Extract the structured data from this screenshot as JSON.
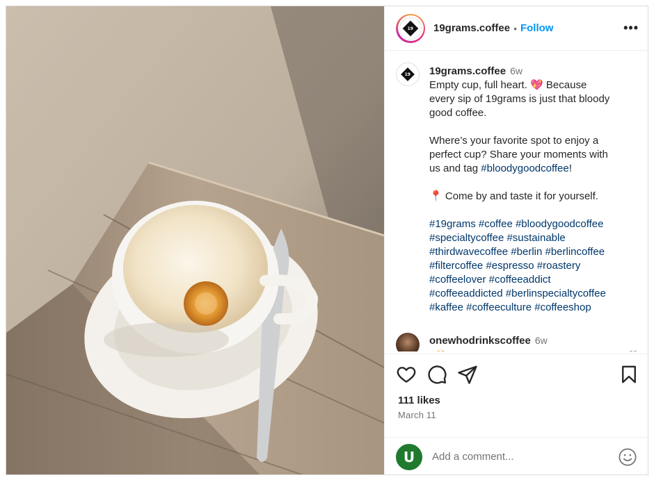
{
  "post": {
    "account": {
      "username": "19grams.coffee",
      "follow_label": "Follow",
      "separator": "•",
      "logo_text": "19"
    },
    "caption": {
      "username": "19grams.coffee",
      "time": "6w",
      "line1": "Empty cup, full heart. 💖 Because",
      "line2": "every sip of 19grams is just that bloody",
      "line3": "good coffee.",
      "line4": "Where’s your favorite spot to enjoy a",
      "line5": "perfect cup? Share your moments with",
      "line6_text": "us and tag ",
      "line6_tag": "#bloodygoodcoffee",
      "line6_end": "!",
      "line7_pin": "📍",
      "line7_text": " Come by and taste it for yourself.",
      "hashtag_lines": [
        "#19grams #coffee #bloodygoodcoffee",
        "#specialtycoffee #sustainable",
        "#thirdwavecoffee #berlin #berlincoffee",
        "#filtercoffee #espresso #roastery",
        "#coffeelover #coffeeaddict",
        "#coffeeaddicted #berlinspecialtycoffee",
        "#kaffee #coffeeculture #coffeeshop"
      ]
    },
    "comments": [
      {
        "username": "onewhodrinkscoffee",
        "time": "6w",
        "text": "☕🙌"
      }
    ],
    "likes": "111 likes",
    "date": "March 11",
    "add_comment": {
      "placeholder": "Add a comment...",
      "avatar_letter": "U"
    },
    "icons": {
      "more": "more-options-icon",
      "like": "heart-icon",
      "comment": "comment-icon",
      "share": "paper-plane-icon",
      "save": "bookmark-icon",
      "emoji": "emoji-icon"
    },
    "colors": {
      "follow": "#0095f6",
      "hashtag": "#00376b",
      "secondary_text": "#737373"
    }
  }
}
